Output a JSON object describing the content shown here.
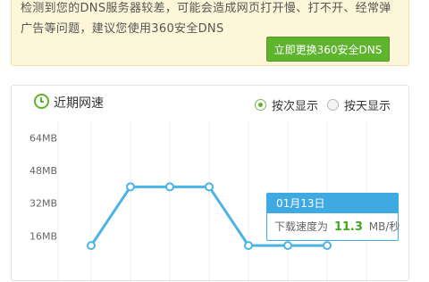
{
  "banner": {
    "line1": "检测到您的DNS服务器较差，可能会造成网页打开慢、打不开、经常弹",
    "line2": "广告等问题，建议您使用360安全DNS",
    "cta_label": "立即更换360安全DNS"
  },
  "panel": {
    "title": "近期网速",
    "clock_icon": "clock-icon",
    "radios": [
      {
        "label": "按次显示",
        "checked": true
      },
      {
        "label": "按天显示",
        "checked": false
      }
    ]
  },
  "colors": {
    "accent_green": "#5fb42e",
    "line_blue": "#4ab4e6",
    "tooltip_blue": "#3fa9e2"
  },
  "chart_data": {
    "type": "line",
    "y_ticks": [
      "64MB",
      "48MB",
      "32MB",
      "16MB"
    ],
    "ylim": [
      0,
      72
    ],
    "x": [
      1,
      2,
      3,
      4,
      5,
      6,
      7
    ],
    "values": [
      11.3,
      40.0,
      40.0,
      40.0,
      11.3,
      11.3,
      11.3
    ],
    "grid": true
  },
  "tooltip": {
    "date": "01月13日",
    "prefix": "下载速度为",
    "value": "11.3",
    "unit": "MB/秒"
  }
}
